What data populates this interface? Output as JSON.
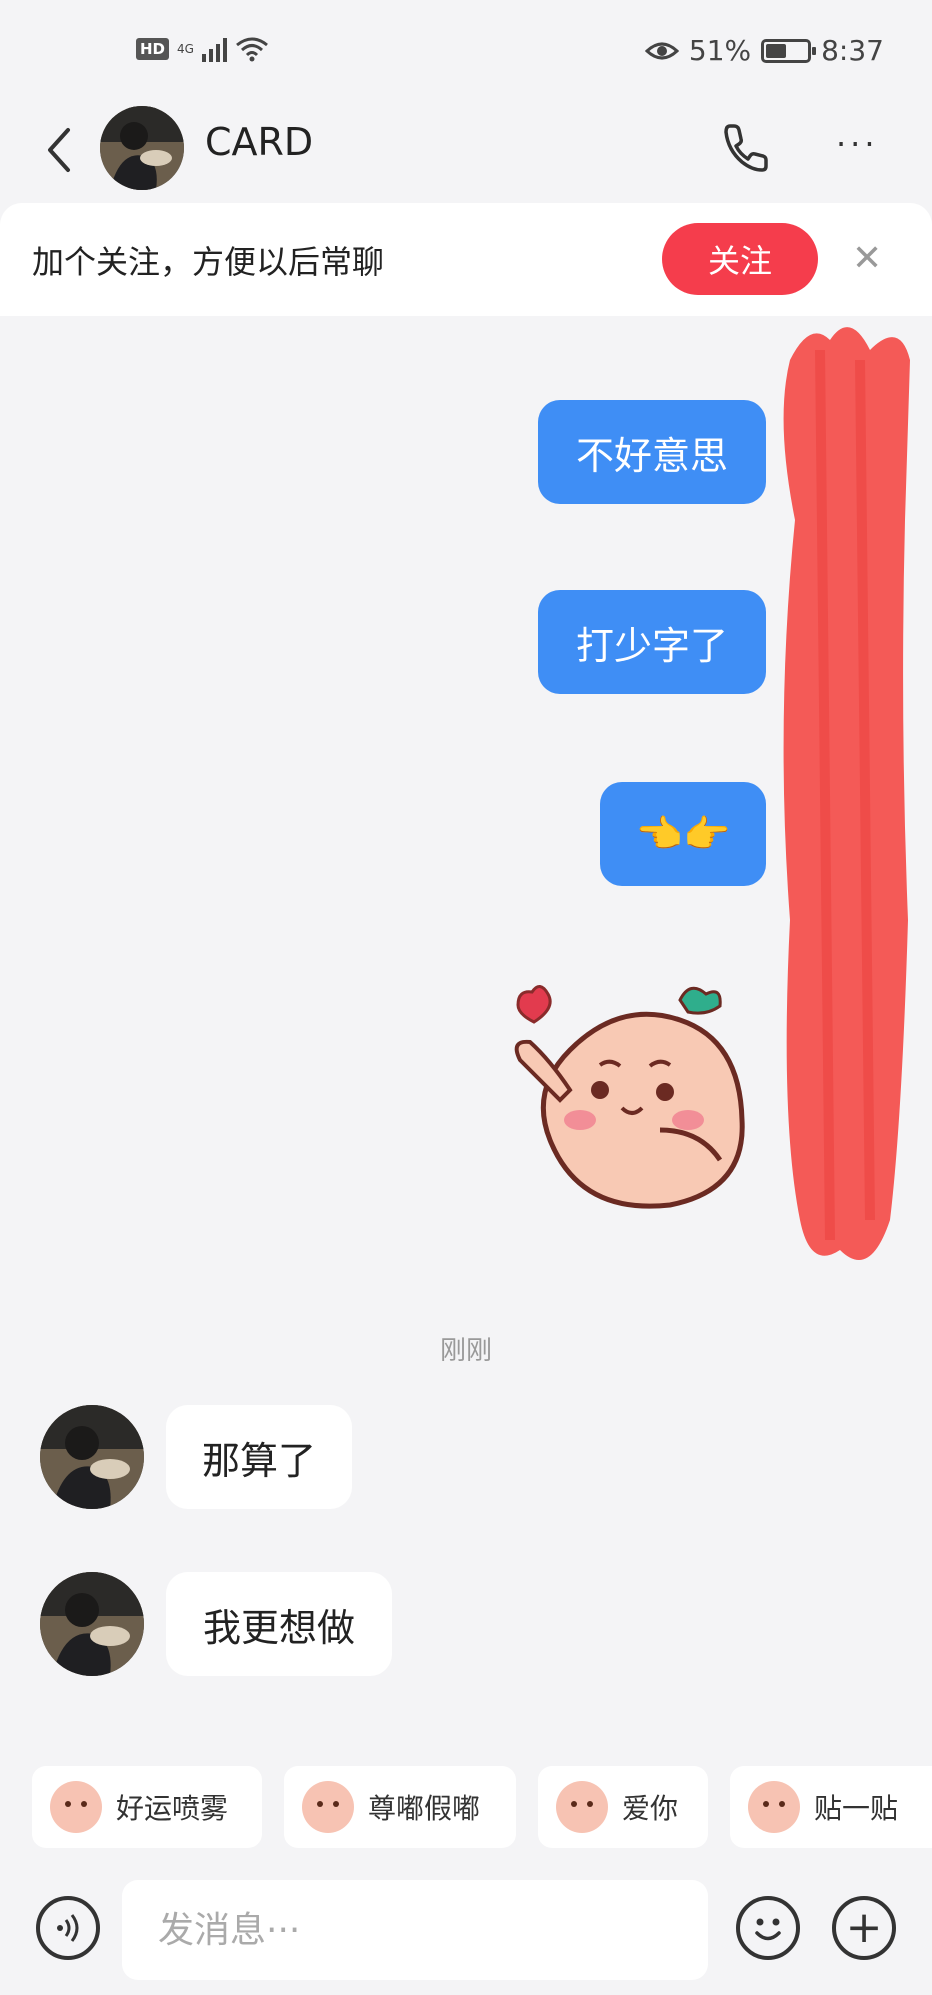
{
  "status_bar": {
    "hd": "HD",
    "network": "4G",
    "battery_percent": "51%",
    "battery_level": 0.51,
    "time": "8:37"
  },
  "header": {
    "contact_name": "CARD",
    "more_label": "···"
  },
  "follow_banner": {
    "text": "加个关注，方便以后常聊",
    "button_label": "关注",
    "close_label": "✕"
  },
  "messages": {
    "sent": [
      "不好意思",
      "打少字了",
      "👈👉"
    ],
    "timestamp": "刚刚",
    "received": [
      "那算了",
      "我更想做"
    ]
  },
  "quick_stickers": [
    "好运喷雾",
    "尊嘟假嘟",
    "爱你",
    "贴一贴"
  ],
  "input_bar": {
    "placeholder": "发消息···",
    "plus_label": "+"
  },
  "colors": {
    "accent_blue": "#3f8ef5",
    "follow_red": "#f53d4c",
    "redaction_red": "#f45a57",
    "background": "#f4f4f6"
  },
  "icons": [
    "back-icon",
    "phone-icon",
    "more-icon",
    "close-icon",
    "voice-icon",
    "emoji-icon",
    "plus-icon"
  ]
}
